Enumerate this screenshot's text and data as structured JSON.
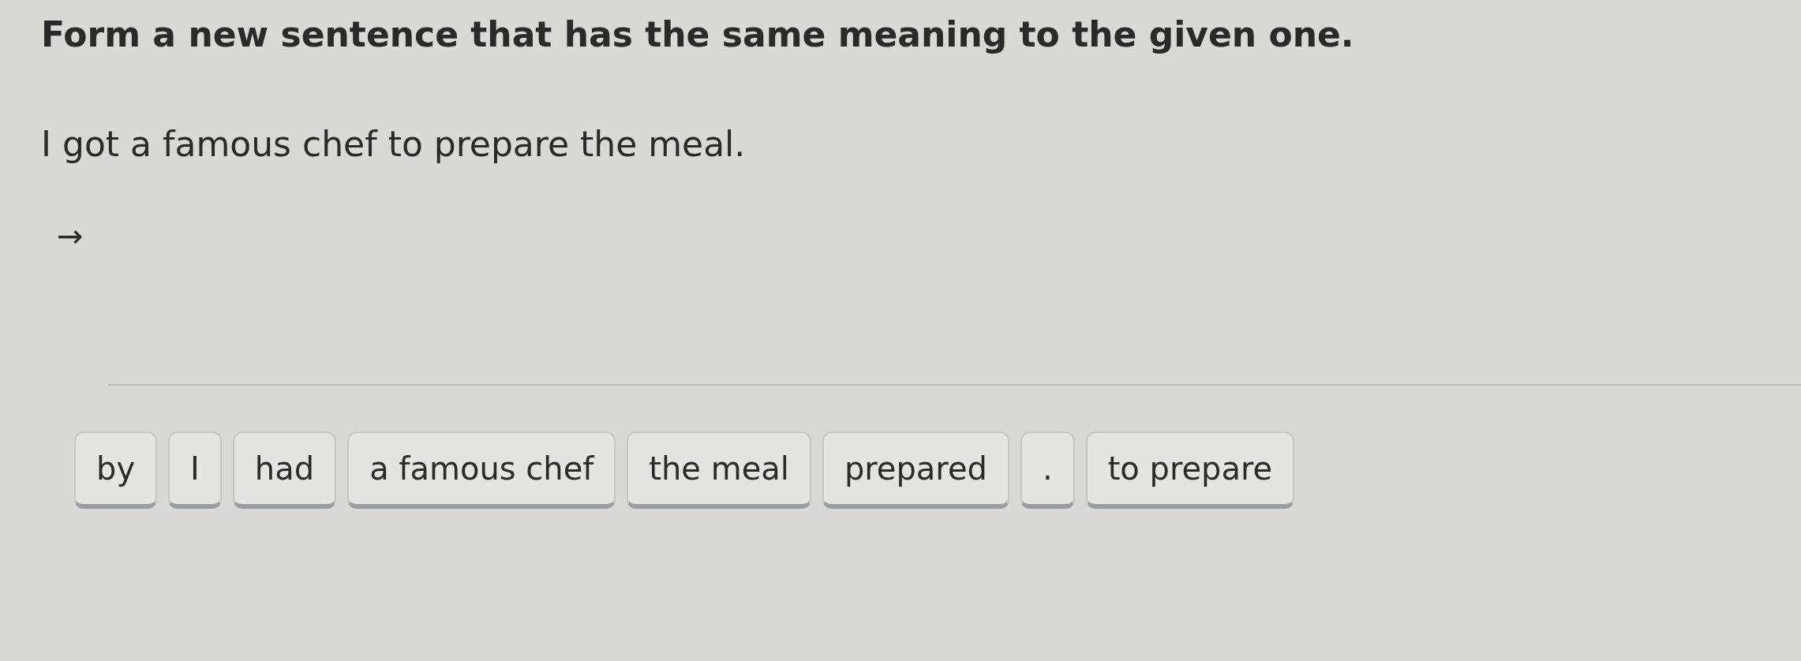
{
  "instruction": "Form a new sentence that has the same meaning to the given one.",
  "sentence": "I got a famous chef to prepare the meal.",
  "answer_arrow": "→",
  "word_tiles": [
    {
      "label": "by"
    },
    {
      "label": "I"
    },
    {
      "label": "had"
    },
    {
      "label": "a famous chef"
    },
    {
      "label": "the meal"
    },
    {
      "label": "prepared"
    },
    {
      "label": "."
    },
    {
      "label": "to prepare"
    }
  ]
}
